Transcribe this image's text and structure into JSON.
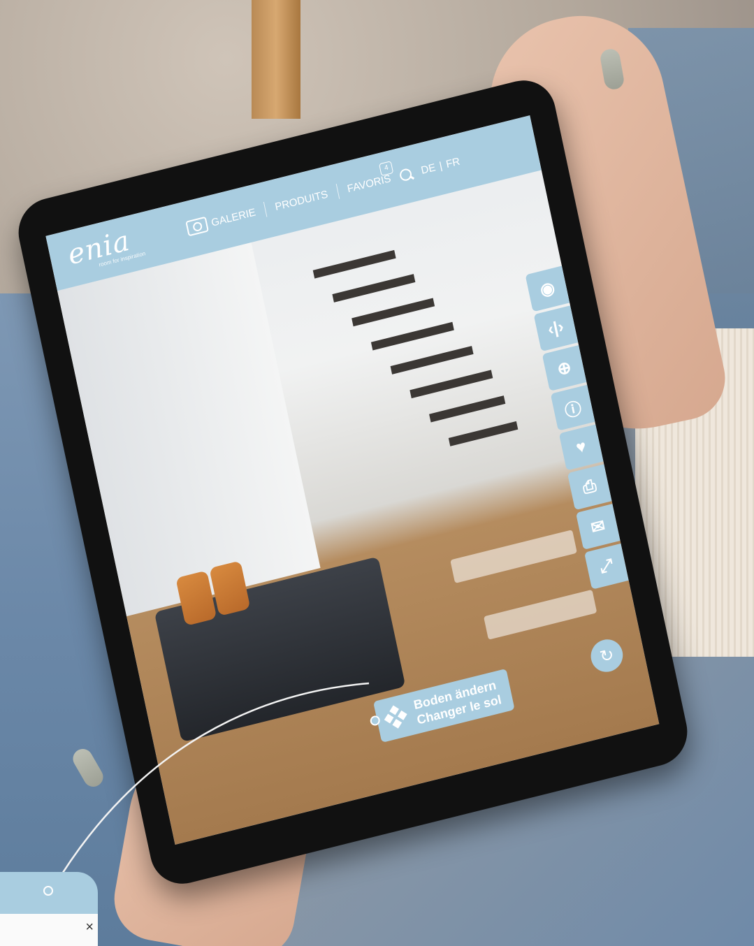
{
  "app": {
    "logo": "enia",
    "logo_subtitle": "room for inspiration",
    "accent_color": "#a9cde0"
  },
  "nav": {
    "gallery_label": "GALERIE",
    "products_label": "PRODUITS",
    "favorites_label": "FAVORIS",
    "favorites_count": "4",
    "lang_de": "DE",
    "lang_sep": "|",
    "lang_fr": "FR"
  },
  "toolbar": {
    "items": [
      "camera-icon",
      "compare-icon",
      "zoom-in-icon",
      "info-icon",
      "favorite-icon",
      "print-icon",
      "mail-icon",
      "fullscreen-icon"
    ]
  },
  "cta": {
    "line1": "Boden ändern",
    "line2": "Changer le sol"
  },
  "popup": {
    "close": "×"
  }
}
